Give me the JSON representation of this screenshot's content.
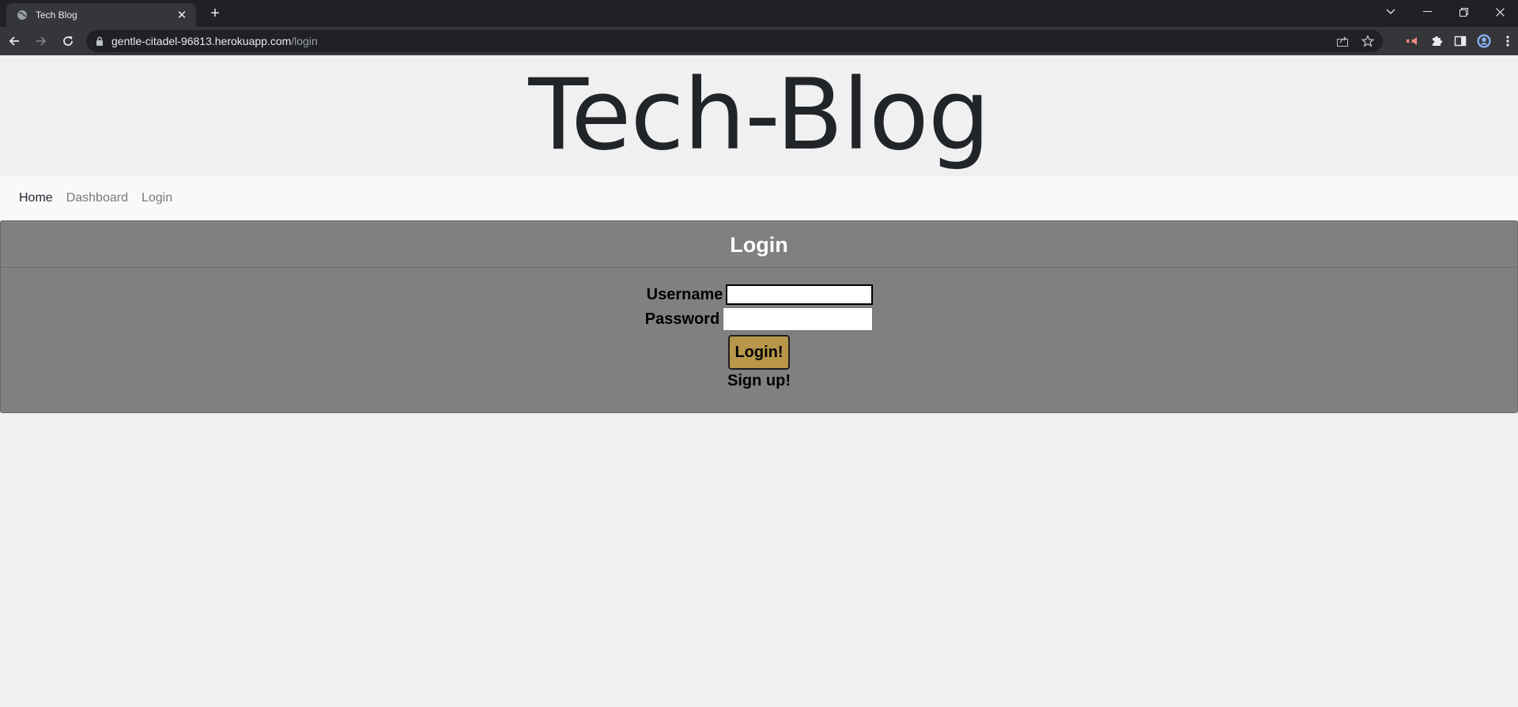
{
  "browser": {
    "tab_title": "Tech Blog",
    "new_tab_symbol": "+",
    "url_host": "gentle-citadel-96813.herokuapp.com",
    "url_path": "/login"
  },
  "site": {
    "title": "Tech-Blog"
  },
  "nav": {
    "items": [
      {
        "label": "Home",
        "active": true
      },
      {
        "label": "Dashboard",
        "active": false
      },
      {
        "label": "Login",
        "active": false
      }
    ]
  },
  "login": {
    "heading": "Login",
    "username_label": "Username",
    "username_value": "",
    "password_label": "Password",
    "password_value": "",
    "submit_label": "Login!",
    "signup_link": "Sign up!"
  },
  "colors": {
    "card_bg": "#808080",
    "button_bg": "#b8974a",
    "page_bg": "#f0f0f0",
    "navbar_bg": "#f8f9fa"
  },
  "icons": {
    "tab_favicon": "globe-icon",
    "back": "back-arrow-icon",
    "forward": "forward-arrow-icon",
    "reload": "reload-icon",
    "lock": "lock-icon",
    "share": "share-icon",
    "bookmark": "star-icon",
    "extension": "puzzle-icon",
    "side_panel": "side-panel-icon",
    "profile": "profile-avatar-icon",
    "menu": "kebab-menu-icon"
  }
}
